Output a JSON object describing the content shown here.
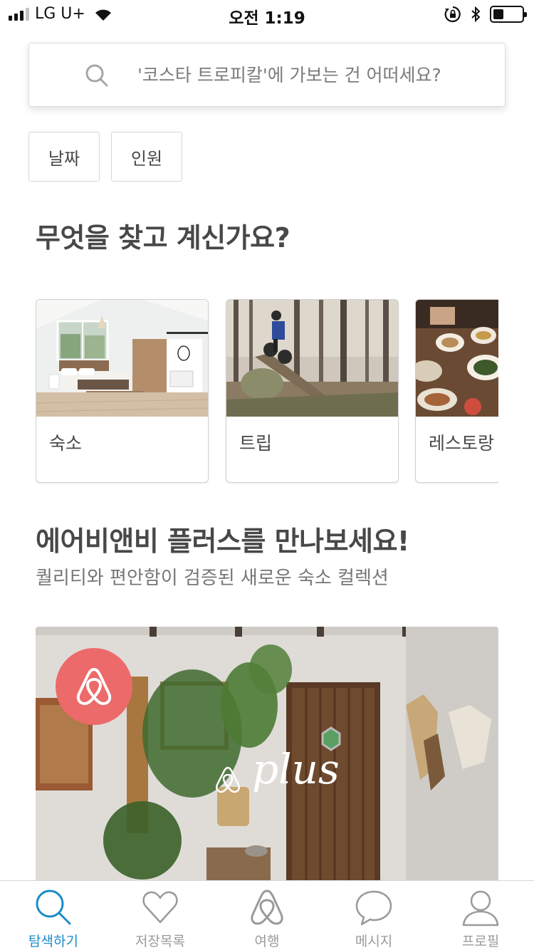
{
  "status_bar": {
    "carrier": "LG U+",
    "time": "오전 1:19",
    "signal_bars_filled": 3,
    "signal_bars_total": 4,
    "icons": [
      "wifi-icon",
      "rotation-lock-icon",
      "bluetooth-icon",
      "battery-icon"
    ]
  },
  "search": {
    "placeholder": "'코스타 트로피칼'에 가보는 건 어떠세요?",
    "icon": "search-icon"
  },
  "filters": {
    "dates_label": "날짜",
    "guests_label": "인원"
  },
  "explore": {
    "title": "무엇을 찾고 계신가요?",
    "categories": [
      {
        "label": "숙소",
        "image": "bedroom-photo"
      },
      {
        "label": "트립",
        "image": "mountain-bike-photo"
      },
      {
        "label": "레스토랑",
        "image": "food-table-photo"
      }
    ]
  },
  "plus": {
    "title": "에어비앤비 플러스를 만나보세요!",
    "subtitle": "퀄리티와 편안함이 검증된 새로운 숙소 컬렉션",
    "wordmark": "plus",
    "logo_color": "#EC6A6A"
  },
  "tab_bar": {
    "active_color": "#1A8CC8",
    "inactive_color": "#9A9A9A",
    "tabs": [
      {
        "label": "탐색하기",
        "icon": "search-icon",
        "active": true
      },
      {
        "label": "저장목록",
        "icon": "heart-icon",
        "active": false
      },
      {
        "label": "여행",
        "icon": "airbnb-logo-icon",
        "active": false
      },
      {
        "label": "메시지",
        "icon": "chat-bubble-icon",
        "active": false
      },
      {
        "label": "프로필",
        "icon": "profile-icon",
        "active": false
      }
    ]
  }
}
